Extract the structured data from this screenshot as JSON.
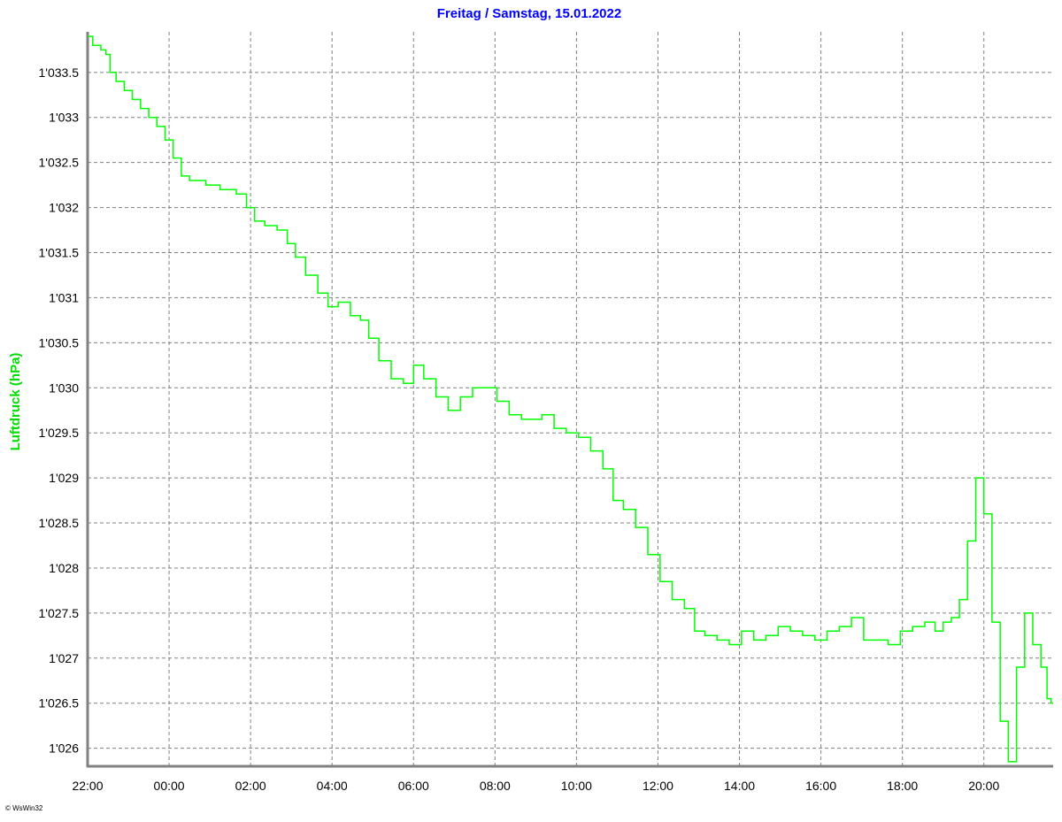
{
  "chart_data": {
    "type": "line",
    "title": "Freitag / Samstag, 15.01.2022",
    "ylabel": "Luftdruck (hPa)",
    "xlabel": "",
    "credit": "© WsWin32",
    "x_tick_labels": [
      "22:00",
      "00:00",
      "02:00",
      "04:00",
      "06:00",
      "08:00",
      "10:00",
      "12:00",
      "14:00",
      "16:00",
      "18:00",
      "20:00"
    ],
    "x_tick_hours": [
      0,
      2,
      4,
      6,
      8,
      10,
      12,
      14,
      16,
      18,
      20,
      22
    ],
    "xlim_hours": [
      0,
      23.7
    ],
    "y_ticks": [
      1026,
      1026.5,
      1027,
      1027.5,
      1028,
      1028.5,
      1029,
      1029.5,
      1030,
      1030.5,
      1031,
      1031.5,
      1032,
      1032.5,
      1033,
      1033.5
    ],
    "y_tick_labels": [
      "1'026",
      "1'026.5",
      "1'027",
      "1'027.5",
      "1'028",
      "1'028.5",
      "1'029",
      "1'029.5",
      "1'030",
      "1'030.5",
      "1'031",
      "1'031.5",
      "1'032",
      "1'032.5",
      "1'033",
      "1'033.5"
    ],
    "ylim": [
      1025.8,
      1033.95
    ],
    "grid": true,
    "colors": {
      "title": "#0000ff",
      "ylabel": "#00dd00",
      "series": "#00ff00",
      "grid": "#808080",
      "axis": "#808080"
    },
    "series": [
      {
        "x_hours": [
          0,
          0.25,
          0.4,
          0.5,
          0.6,
          0.8,
          1.0,
          1.2,
          1.4,
          1.6,
          1.8,
          2.0,
          2.2,
          2.4,
          2.6,
          2.8,
          3.0,
          3.5,
          3.8,
          4.0,
          4.2,
          4.5,
          4.8,
          5.0,
          5.2,
          5.5,
          5.8,
          6.0,
          6.3,
          6.6,
          6.8,
          7.0,
          7.3,
          7.6,
          7.9,
          8.1,
          8.4,
          8.7,
          9.0,
          9.3,
          9.6,
          9.9,
          10.2,
          10.5,
          10.8,
          11.0,
          11.3,
          11.6,
          11.9,
          12.2,
          12.5,
          12.8,
          13.0,
          13.3,
          13.6,
          13.9,
          14.2,
          14.5,
          14.8,
          15.0,
          15.3,
          15.6,
          15.9,
          16.2,
          16.5,
          16.8,
          17.1,
          17.4,
          17.7,
          18.0,
          18.3,
          18.6,
          18.9,
          19.2,
          19.5,
          19.8,
          20.1,
          20.4,
          20.7,
          20.9,
          21.1,
          21.3,
          21.5,
          21.7,
          21.9,
          22.1,
          22.3,
          22.5,
          22.7,
          22.9,
          23.1,
          23.3,
          23.5,
          23.6,
          23.7
        ],
        "values": [
          1033.9,
          1033.8,
          1033.75,
          1033.7,
          1033.5,
          1033.4,
          1033.3,
          1033.2,
          1033.1,
          1033.0,
          1032.9,
          1032.75,
          1032.55,
          1032.35,
          1032.3,
          1032.3,
          1032.25,
          1032.2,
          1032.15,
          1032.0,
          1031.85,
          1031.8,
          1031.75,
          1031.6,
          1031.45,
          1031.25,
          1031.05,
          1030.9,
          1030.95,
          1030.8,
          1030.75,
          1030.55,
          1030.3,
          1030.1,
          1030.05,
          1030.25,
          1030.1,
          1029.9,
          1029.75,
          1029.9,
          1030.0,
          1030.0,
          1029.85,
          1029.7,
          1029.65,
          1029.65,
          1029.7,
          1029.55,
          1029.5,
          1029.45,
          1029.3,
          1029.1,
          1028.75,
          1028.65,
          1028.45,
          1028.15,
          1027.85,
          1027.65,
          1027.55,
          1027.3,
          1027.25,
          1027.2,
          1027.15,
          1027.3,
          1027.2,
          1027.25,
          1027.35,
          1027.3,
          1027.25,
          1027.2,
          1027.3,
          1027.35,
          1027.45,
          1027.2,
          1027.2,
          1027.15,
          1027.3,
          1027.35,
          1027.4,
          1027.3,
          1027.4,
          1027.45,
          1027.65,
          1028.3,
          1029.0,
          1028.6,
          1027.4,
          1026.3,
          1025.85,
          1026.9,
          1027.5,
          1027.15,
          1026.9,
          1026.55,
          1026.5
        ]
      }
    ]
  }
}
